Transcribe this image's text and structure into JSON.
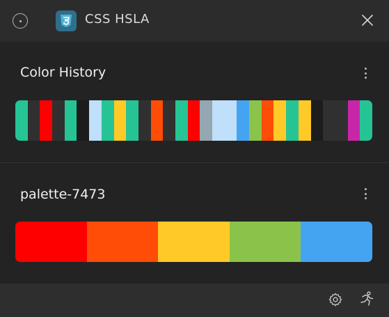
{
  "titlebar": {
    "title": "CSS HSLA",
    "app_icon": "css3-icon",
    "app_icon_glyph": "3"
  },
  "history": {
    "title": "Color History",
    "colors": [
      "#26c495",
      "#303030",
      "#ff0000",
      "#303030",
      "#26c495",
      "#1c1c1c",
      "#bfdffb",
      "#26c495",
      "#ffc927",
      "#26c495",
      "#303030",
      "#ff4c06",
      "#303030",
      "#26c495",
      "#ff0000",
      "#94a7b0",
      "#bfdffb",
      "#bfdffb",
      "#45a4f2",
      "#8bc34a",
      "#ff4c06",
      "#ffc927",
      "#26c495",
      "#ffc927",
      "#1c1c1c",
      "#303030",
      "#303030",
      "#c826a8",
      "#26c495"
    ]
  },
  "palette": {
    "title": "palette-7473",
    "colors": [
      "#ff0000",
      "#ff4c06",
      "#ffc927",
      "#8bc34a",
      "#45a4f2"
    ]
  },
  "footer": {
    "settings_icon": "gear-icon",
    "extra_icon": "runner-icon"
  }
}
